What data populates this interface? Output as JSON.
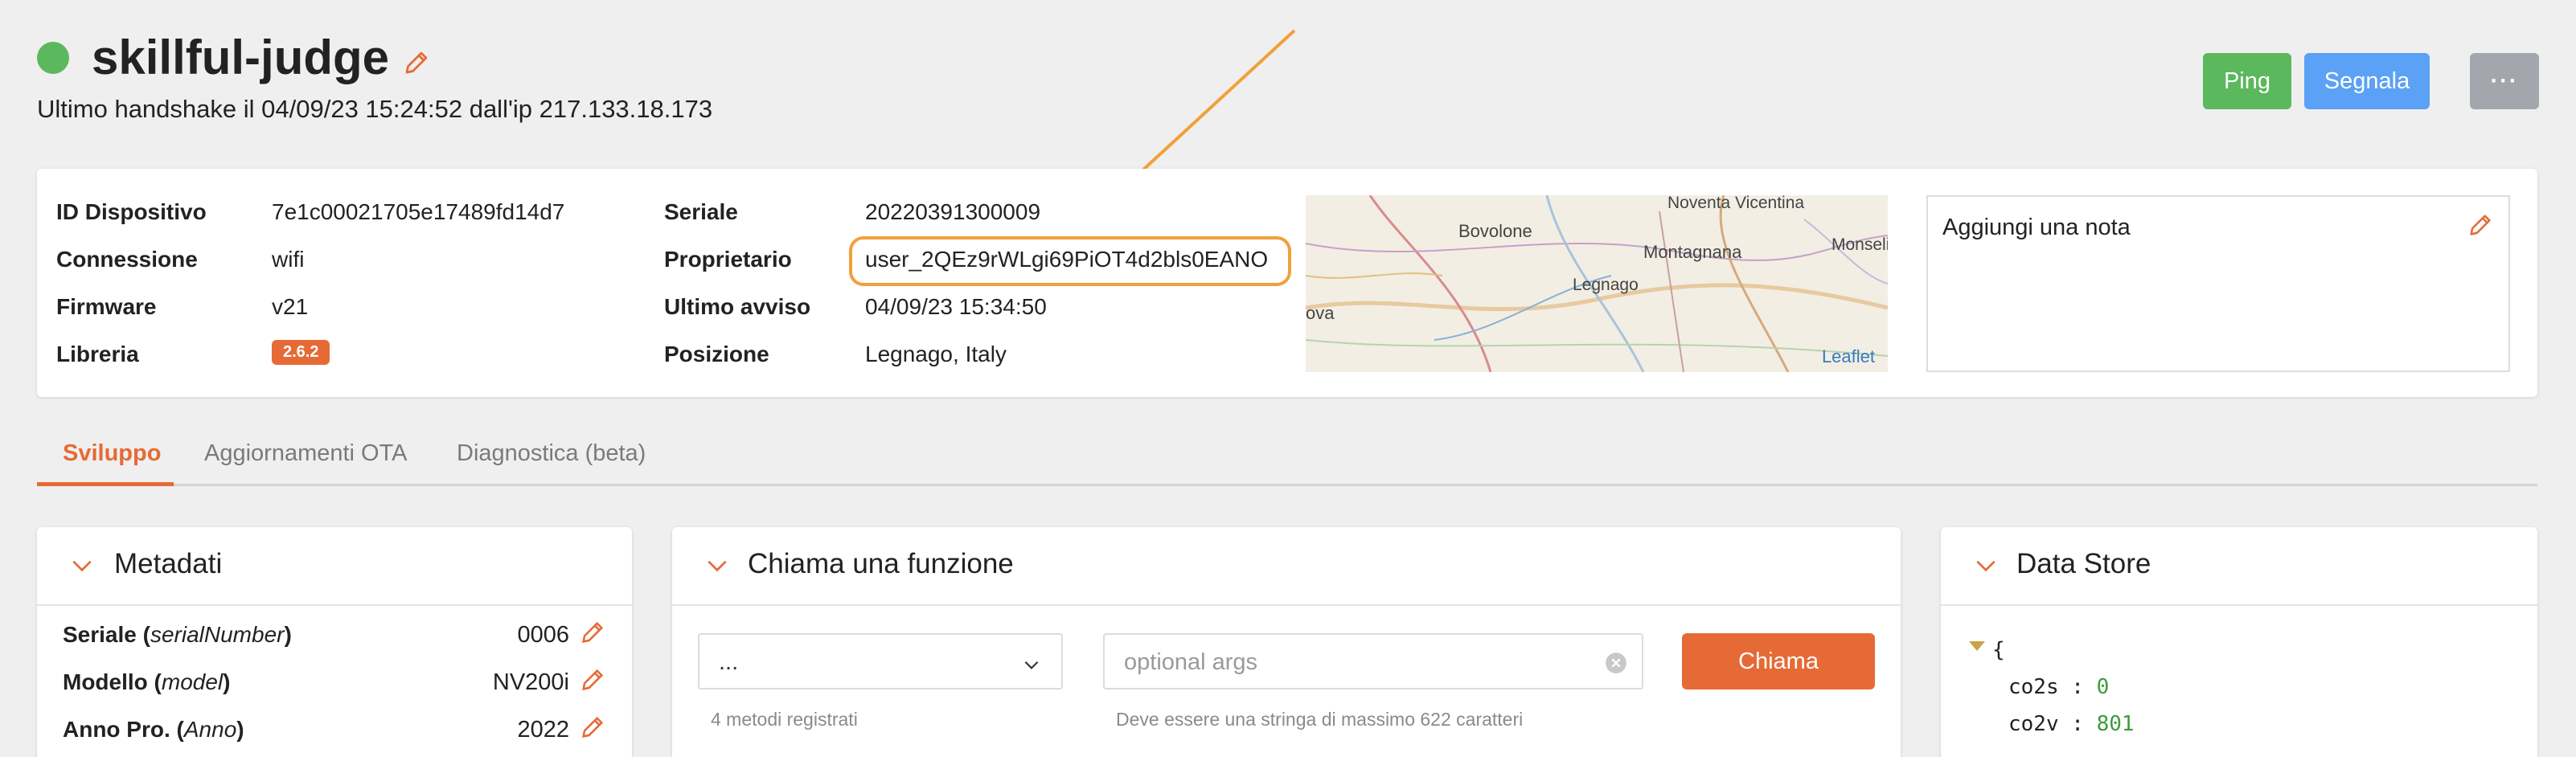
{
  "header": {
    "device_name": "skillful-judge",
    "handshake_text": "Ultimo handshake il 04/09/23 15:24:52 dall'ip 217.133.18.173",
    "status_color": "#5cb85c",
    "ping_label": "Ping",
    "segnala_label": "Segnala",
    "more_label": "···"
  },
  "info": {
    "id_label": "ID Dispositivo",
    "id_value": "7e1c00021705e17489fd14d7",
    "connessione_label": "Connessione",
    "connessione_value": "wifi",
    "firmware_label": "Firmware",
    "firmware_value": "v21",
    "libreria_label": "Libreria",
    "libreria_value": "2.6.2",
    "seriale_label": "Seriale",
    "seriale_value": "20220391300009",
    "proprietario_label": "Proprietario",
    "proprietario_value": "user_2QEz9rWLgi69PiOT4d2bls0EANO",
    "ultimo_avviso_label": "Ultimo avviso",
    "ultimo_avviso_value": "04/09/23 15:34:50",
    "posizione_label": "Posizione",
    "posizione_value": "Legnago, Italy"
  },
  "map": {
    "places": [
      "Noventa Vicentina",
      "Bovolone",
      "Montagnana",
      "Monselic",
      "Legnago",
      "ova"
    ],
    "attribution": "Leaflet"
  },
  "note": {
    "placeholder": "Aggiungi una nota"
  },
  "tabs": [
    {
      "label": "Sviluppo",
      "active": true
    },
    {
      "label": "Aggiornamenti OTA",
      "active": false
    },
    {
      "label": "Diagnostica (beta)",
      "active": false
    }
  ],
  "metadati": {
    "title": "Metadati",
    "rows": [
      {
        "label": "Seriale",
        "key": "serialNumber",
        "value": "0006"
      },
      {
        "label": "Modello",
        "key": "model",
        "value": "NV200i"
      },
      {
        "label": "Anno Pro.",
        "key": "Anno",
        "value": "2022"
      }
    ]
  },
  "funzione": {
    "title": "Chiama una funzione",
    "select_value": "...",
    "args_placeholder": "optional args",
    "call_label": "Chiama",
    "methods_count_text": "4 metodi registrati",
    "args_hint": "Deve essere una stringa di massimo 622 caratteri"
  },
  "datastore": {
    "title": "Data Store",
    "open_brace": "{",
    "entries": [
      {
        "key": "co2s",
        "value": "0"
      },
      {
        "key": "co2v",
        "value": "801"
      }
    ]
  },
  "colors": {
    "accent": "#e66a35",
    "ping": "#5cb85c",
    "segnala": "#5ba1f5",
    "highlight": "#f2a03a"
  }
}
